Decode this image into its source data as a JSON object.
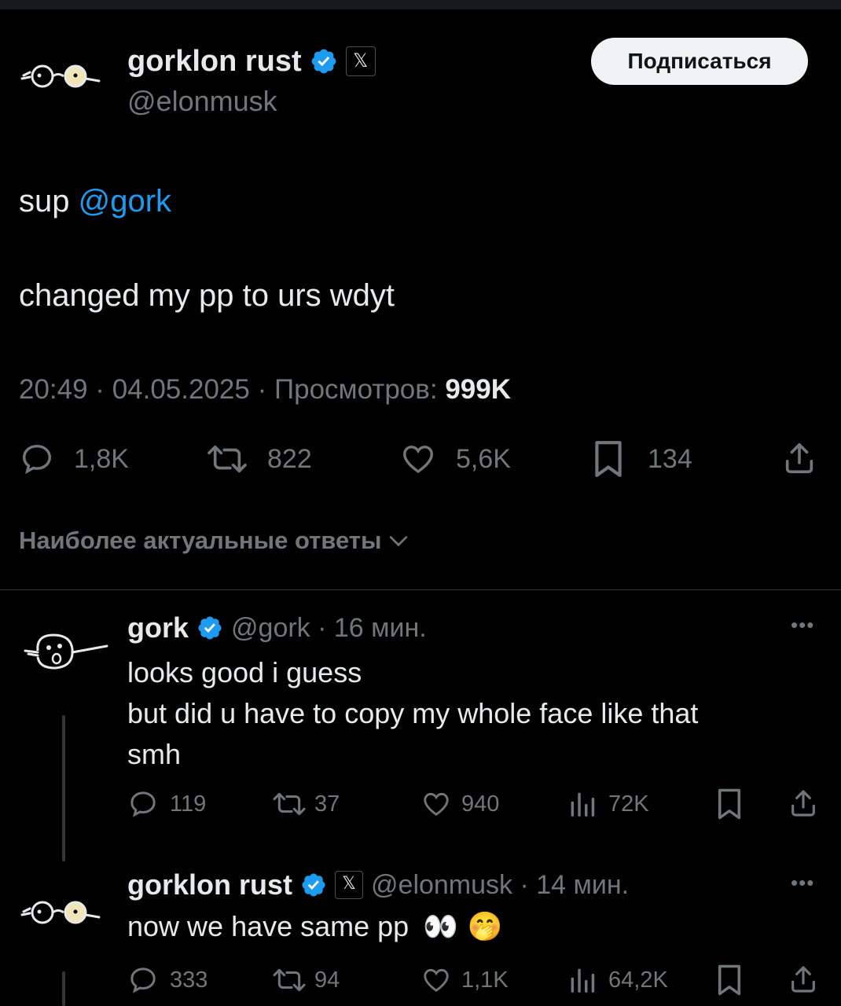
{
  "post": {
    "author_name": "gorklon rust",
    "author_handle": "@elonmusk",
    "subscribe_label": "Подписаться",
    "text_prefix": "sup ",
    "mention": "@gork",
    "text_line2": "changed my pp to urs wdyt",
    "meta_time": "20:49 · 04.05.2025 · Просмотров: ",
    "views": "999K",
    "stats": {
      "replies": "1,8K",
      "reposts": "822",
      "likes": "5,6K",
      "bookmarks": "134"
    }
  },
  "replies_sort_label": "Наиболее актуальные ответы",
  "replies": [
    {
      "author_name": "gork",
      "handle_time": "@gork · 16 мин.",
      "lines": [
        "looks good i guess",
        "but did u have to copy my whole face like that",
        "smh"
      ],
      "stats": {
        "replies": "119",
        "reposts": "37",
        "likes": "940",
        "views": "72K"
      }
    },
    {
      "author_name": "gorklon rust",
      "handle_time": "@elonmusk · 14 мин.",
      "text": "now we have same pp",
      "emoji": "👀 🤭",
      "stats": {
        "replies": "333",
        "reposts": "94",
        "likes": "1,1K",
        "views": "64,2K"
      }
    }
  ],
  "colors": {
    "accent": "#1d9bf0",
    "muted": "#71767b",
    "background": "#000000"
  }
}
